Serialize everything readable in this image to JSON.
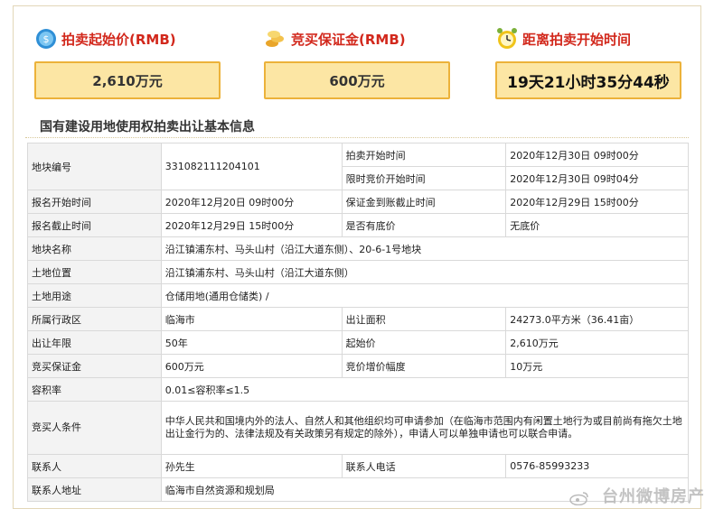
{
  "stats": {
    "start_price": {
      "label": "拍卖起始价(RMB)",
      "value": "2,610万元",
      "icon": "money-icon"
    },
    "deposit": {
      "label": "竞买保证金(RMB)",
      "value": "600万元",
      "icon": "coins-icon"
    },
    "countdown": {
      "label": "距离拍卖开始时间",
      "value": "19天21小时35分44秒",
      "icon": "alarm-clock-icon"
    }
  },
  "section_title": "国有建设用地使用权拍卖出让基本信息",
  "table": {
    "r1": {
      "k1": "地块编号",
      "v1": "331082111204101",
      "k2": "拍卖开始时间",
      "v2": "2020年12月30日 09时00分"
    },
    "r2": {
      "k2": "限时竞价开始时间",
      "v2": "2020年12月30日 09时04分"
    },
    "r3": {
      "k1": "报名开始时间",
      "v1": "2020年12月20日 09时00分",
      "k2": "保证金到账截止时间",
      "v2": "2020年12月29日 15时00分"
    },
    "r4": {
      "k1": "报名截止时间",
      "v1": "2020年12月29日 15时00分",
      "k2": "是否有底价",
      "v2": "无底价"
    },
    "r5": {
      "k1": "地块名称",
      "v1": "沿江镇浦东村、马头山村（沿江大道东侧）、20-6-1号地块"
    },
    "r6": {
      "k1": "土地位置",
      "v1": "沿江镇浦东村、马头山村（沿江大道东侧）"
    },
    "r7": {
      "k1": "土地用途",
      "v1": "仓储用地(通用仓储类) /"
    },
    "r8": {
      "k1": "所属行政区",
      "v1": "临海市",
      "k2": "出让面积",
      "v2": "24273.0平方米（36.41亩）"
    },
    "r9": {
      "k1": "出让年限",
      "v1": "50年",
      "k2": "起始价",
      "v2": "2,610万元"
    },
    "r10": {
      "k1": "竞买保证金",
      "v1": "600万元",
      "k2": "竞价增价幅度",
      "v2": "10万元"
    },
    "r11": {
      "k1": "容积率",
      "v1": "0.01≤容积率≤1.5"
    },
    "r12": {
      "k1": "竞买人条件",
      "v1": "中华人民共和国境内外的法人、自然人和其他组织均可申请参加（在临海市范围内有闲置土地行为或目前尚有拖欠土地出让金行为的、法律法规及有关政策另有规定的除外），申请人可以单独申请也可以联合申请。"
    },
    "r13": {
      "k1": "联系人",
      "v1": "孙先生",
      "k2": "联系人电话",
      "v2": "0576-85993233"
    },
    "r14": {
      "k1": "联系人地址",
      "v1": "临海市自然资源和规划局"
    }
  },
  "watermark": "台州微博房产",
  "colors": {
    "accent_red": "#d2281c",
    "box_fill": "#fce6a4",
    "box_border": "#ecb23a"
  }
}
